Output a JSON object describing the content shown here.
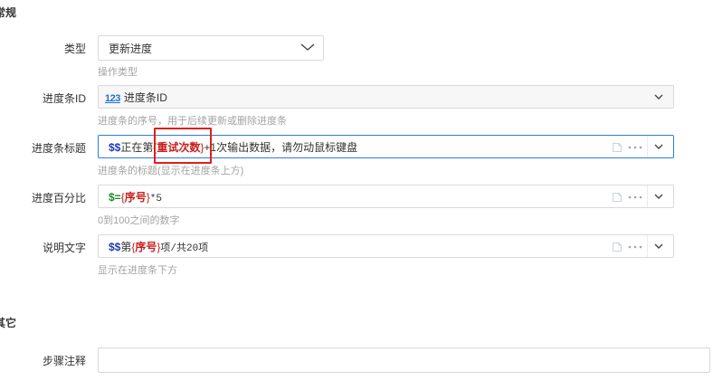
{
  "sections": {
    "general_title": "常规",
    "other_title": "其它"
  },
  "fields": {
    "type": {
      "label": "类型",
      "value": "更新进度",
      "hint": "操作类型"
    },
    "progress_id": {
      "label": "进度条ID",
      "badge": "123",
      "value": "进度条ID",
      "hint": "进度条的序号，用于后续更新或删除进度条"
    },
    "progress_title": {
      "label": "进度条标题",
      "expr": {
        "prefix": "$$",
        "before": "正在第",
        "var_open": "{",
        "var_name": "重试次数",
        "var_close": "}",
        "after": "+1次输出数据，请勿动鼠标键盘"
      },
      "hint": "进度条的标题(显示在进度条上方)"
    },
    "progress_percent": {
      "label": "进度百分比",
      "expr": {
        "prefix": "$=",
        "var_open": "{",
        "var_name": "序号",
        "var_close": "}",
        "after": "*5"
      },
      "hint": "0到100之间的数字"
    },
    "description": {
      "label": "说明文字",
      "expr": {
        "prefix": "$$",
        "before": "第",
        "var_open": "{",
        "var_name": "序号",
        "var_close": "}",
        "after": "项/共20项"
      },
      "hint": "显示在进度条下方"
    },
    "step_note": {
      "label": "步骤注释",
      "value": "",
      "placeholder": ""
    }
  },
  "icons": {
    "chevron": "chevron-down-icon",
    "doc": "document-icon",
    "more": "more-icon"
  },
  "colors": {
    "accent": "#2d7de0",
    "highlight_box": "#e0201a",
    "var_red": "#c81e1e",
    "dollar_blue": "#1a3bb5",
    "equal_green": "#1f8a1f"
  }
}
